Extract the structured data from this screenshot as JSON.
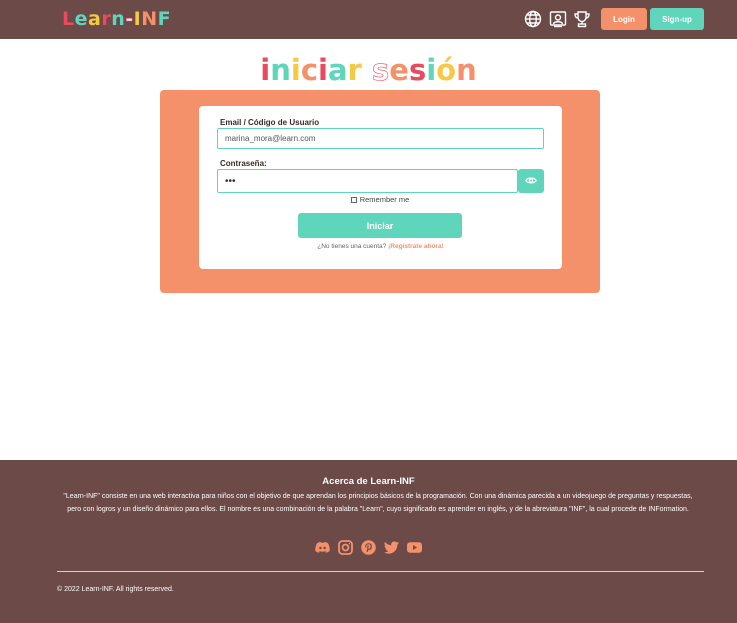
{
  "header": {
    "logo_text": "Learn-INF",
    "logo_colors": [
      "#e84a5f",
      "#5fd6bc",
      "#f6c945",
      "#e84a5f",
      "#5fd6bc",
      "#ffffff",
      "#f6c945",
      "#f4916b",
      "#5fd6bc"
    ],
    "icons": [
      "globe-icon",
      "profile-icon",
      "trophy-icon"
    ],
    "login_label": "Login",
    "signup_label": "Sign-up"
  },
  "page_title": {
    "text": "iniciar sesión",
    "colors": [
      "#e84a5f",
      "#5fd6bc",
      "#f6c945",
      "#f4916b",
      "#e84a5f",
      "#5fd6bc",
      "#f6c945",
      "#ffffff",
      "#f4916b",
      "#e84a5f",
      "#5fd6bc",
      "#f6c945",
      "#f4916b",
      "#e84a5f"
    ]
  },
  "form": {
    "email_label": "Email / Código de Usuario",
    "email_value": "marina_mora@learn.com",
    "password_label": "Contraseña:",
    "password_value": "•••",
    "remember_label": "Remember me",
    "submit_label": "Iniciar",
    "no_account_text": "¿No tienes una cuenta?",
    "register_link": "¡Regístrate ahora!"
  },
  "footer": {
    "title": "Acerca de Learn-INF",
    "description": "\"Learn-INF\" consiste en una web interactiva para niños con el objetivo de que aprendan los principios básicos de la programación. Con una dinámica parecida a un videojuego de preguntas y respuestas, pero con logros y un diseño dinámico para ellos. El nombre es una combinación de la palabra \"Learn\", cuyo significado es aprender en inglés, y de la abreviatura \"INF\", la cual procede de INFormation.",
    "social_icons": [
      "discord-icon",
      "instagram-icon",
      "pinterest-icon",
      "twitter-icon",
      "youtube-icon"
    ],
    "copyright": "© 2022 Learn-INF. All rights reserved."
  },
  "colors": {
    "brown": "#6b4a47",
    "salmon": "#f4916b",
    "teal": "#5fd6bc",
    "yellow": "#f6c945",
    "red": "#e84a5f"
  }
}
